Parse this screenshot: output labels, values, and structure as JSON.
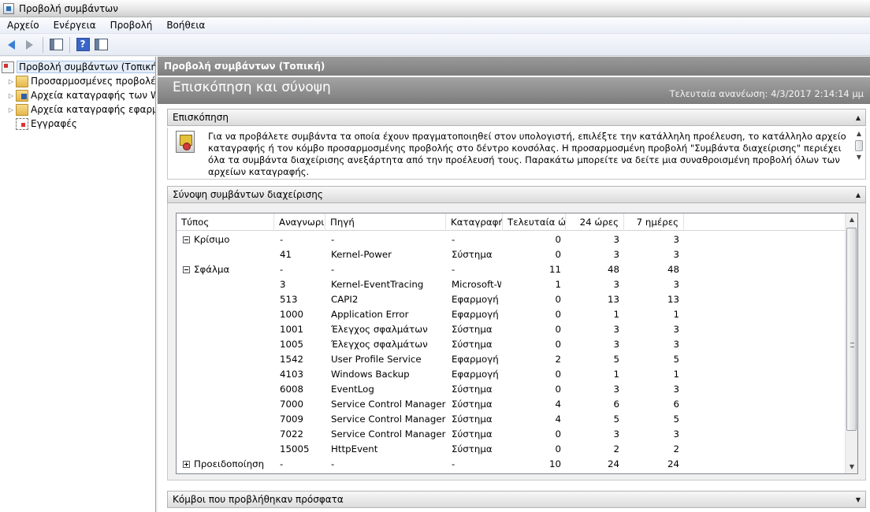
{
  "window": {
    "title": "Προβολή συμβάντων"
  },
  "menu": [
    "Αρχείο",
    "Ενέργεια",
    "Προβολή",
    "Βοήθεια"
  ],
  "tree": {
    "items": [
      {
        "label": "Προβολή συμβάντων (Τοπική)",
        "icon": "event-viewer-icon"
      },
      {
        "label": "Προσαρμοσμένες προβολές",
        "icon": "folder-icon"
      },
      {
        "label": "Αρχεία καταγραφής των Windows",
        "icon": "folder-icon"
      },
      {
        "label": "Αρχεία καταγραφής εφαρμογών και υπηρεσιών",
        "icon": "folder-icon"
      },
      {
        "label": "Εγγραφές",
        "icon": "subscriptions-icon"
      }
    ]
  },
  "main": {
    "header": "Προβολή συμβάντων (Τοπική)",
    "banner_title": "Επισκόπηση και σύνοψη",
    "last_refresh": "Τελευταία ανανέωση: 4/3/2017 2:14:14 μμ"
  },
  "overview": {
    "title": "Επισκόπηση",
    "text": "Για να προβάλετε συμβάντα τα οποία έχουν πραγματοποιηθεί στον υπολογιστή, επιλέξτε την κατάλληλη προέλευση, το κατάλληλο αρχείο καταγραφής ή τον κόμβο προσαρμοσμένης προβολής στο δέντρο κονσόλας. Η προσαρμοσμένη προβολή \"Συμβάντα διαχείρισης\" περιέχει όλα τα συμβάντα διαχείρισης ανεξάρτητα από την προέλευσή τους. Παρακάτω μπορείτε να δείτε μια συναθροισμένη προβολή όλων των αρχείων καταγραφής."
  },
  "summary": {
    "title": "Σύνοψη συμβάντων διαχείρισης",
    "columns": [
      "Τύπος",
      "Αναγνωριστικό συμβάντος",
      "Πηγή",
      "Καταγραφή",
      "Τελευταία ώρα",
      "24 ώρες",
      "7 ημέρες"
    ],
    "rows": [
      {
        "type": "Κρίσιμο",
        "expander": "minus",
        "id": "-",
        "source": "-",
        "log": "-",
        "last_hour": "0",
        "h24": "3",
        "d7": "3"
      },
      {
        "type": "",
        "id": "41",
        "source": "Kernel-Power",
        "log": "Σύστημα",
        "last_hour": "0",
        "h24": "3",
        "d7": "3"
      },
      {
        "type": "Σφάλμα",
        "expander": "minus",
        "id": "-",
        "source": "-",
        "log": "-",
        "last_hour": "11",
        "h24": "48",
        "d7": "48"
      },
      {
        "type": "",
        "id": "3",
        "source": "Kernel-EventTracing",
        "log": "Microsoft-Windows-Kernel-EventTracing/Admin",
        "last_hour": "1",
        "h24": "3",
        "d7": "3"
      },
      {
        "type": "",
        "id": "513",
        "source": "CAPI2",
        "log": "Εφαρμογή",
        "last_hour": "0",
        "h24": "13",
        "d7": "13"
      },
      {
        "type": "",
        "id": "1000",
        "source": "Application Error",
        "log": "Εφαρμογή",
        "last_hour": "0",
        "h24": "1",
        "d7": "1"
      },
      {
        "type": "",
        "id": "1001",
        "source": "Έλεγχος σφαλμάτων",
        "log": "Σύστημα",
        "last_hour": "0",
        "h24": "3",
        "d7": "3"
      },
      {
        "type": "",
        "id": "1005",
        "source": "Έλεγχος σφαλμάτων",
        "log": "Σύστημα",
        "last_hour": "0",
        "h24": "3",
        "d7": "3"
      },
      {
        "type": "",
        "id": "1542",
        "source": "User Profile Service",
        "log": "Εφαρμογή",
        "last_hour": "2",
        "h24": "5",
        "d7": "5"
      },
      {
        "type": "",
        "id": "4103",
        "source": "Windows Backup",
        "log": "Εφαρμογή",
        "last_hour": "0",
        "h24": "1",
        "d7": "1"
      },
      {
        "type": "",
        "id": "6008",
        "source": "EventLog",
        "log": "Σύστημα",
        "last_hour": "0",
        "h24": "3",
        "d7": "3"
      },
      {
        "type": "",
        "id": "7000",
        "source": "Service Control Manager",
        "log": "Σύστημα",
        "last_hour": "4",
        "h24": "6",
        "d7": "6"
      },
      {
        "type": "",
        "id": "7009",
        "source": "Service Control Manager",
        "log": "Σύστημα",
        "last_hour": "4",
        "h24": "5",
        "d7": "5"
      },
      {
        "type": "",
        "id": "7022",
        "source": "Service Control Manager",
        "log": "Σύστημα",
        "last_hour": "0",
        "h24": "3",
        "d7": "3"
      },
      {
        "type": "",
        "id": "15005",
        "source": "HttpEvent",
        "log": "Σύστημα",
        "last_hour": "0",
        "h24": "2",
        "d7": "2"
      },
      {
        "type": "Προειδοποίηση",
        "expander": "plus",
        "id": "-",
        "source": "-",
        "log": "-",
        "last_hour": "10",
        "h24": "24",
        "d7": "24"
      }
    ]
  },
  "recent_nodes": {
    "title": "Κόμβοι που προβλήθηκαν πρόσφατα"
  }
}
